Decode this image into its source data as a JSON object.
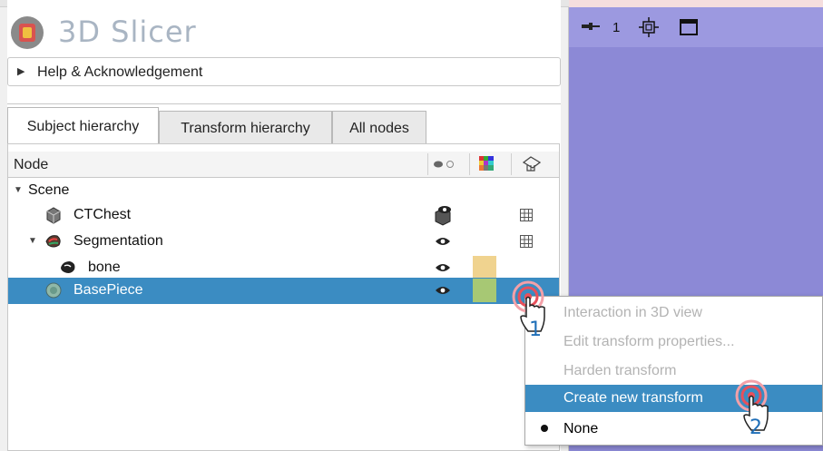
{
  "app": {
    "title": "3D Slicer"
  },
  "help_section": {
    "label": "Help & Acknowledgement"
  },
  "tabs": [
    {
      "label": "Subject hierarchy",
      "active": true
    },
    {
      "label": "Transform hierarchy",
      "active": false
    },
    {
      "label": "All nodes",
      "active": false
    }
  ],
  "tree": {
    "columns": {
      "node": "Node",
      "visibility_icon": "eye-toggle-icon",
      "color_icon": "color-palette-icon",
      "transform_icon": "transform-icon"
    },
    "rows": [
      {
        "label": "Scene",
        "icon": "scene",
        "level": 0,
        "expanded": true
      },
      {
        "label": "CTChest",
        "icon": "volume-icon",
        "level": 1
      },
      {
        "label": "Segmentation",
        "icon": "segmentation-icon",
        "level": 1,
        "expanded": true
      },
      {
        "label": "bone",
        "icon": "segment-icon",
        "level": 2,
        "color": "#f0d38f"
      },
      {
        "label": "BasePiece",
        "icon": "model-icon",
        "level": 1,
        "color": "#a7c874",
        "selected": true
      }
    ]
  },
  "viewer_bar": {
    "pin_icon": "pin-icon",
    "view_index": "1",
    "center_icon": "center-view-icon",
    "maximize_icon": "maximize-icon"
  },
  "context_menu": {
    "items": [
      {
        "label": "Interaction in 3D view",
        "disabled": true
      },
      {
        "label": "Edit transform properties...",
        "disabled": true
      },
      {
        "label": "Harden transform",
        "disabled": true
      },
      {
        "label": "Create new transform",
        "highlighted": true
      },
      {
        "label": "None",
        "checked": true
      }
    ]
  },
  "annotations": {
    "step1": "1",
    "step2": "2"
  },
  "colors": {
    "selection": "#3b8cc2",
    "viewer_bg": "#8c89d6",
    "bone_color": "#f0d38f",
    "basepiece_color": "#a7c874",
    "step_label": "#1f6fb8"
  }
}
